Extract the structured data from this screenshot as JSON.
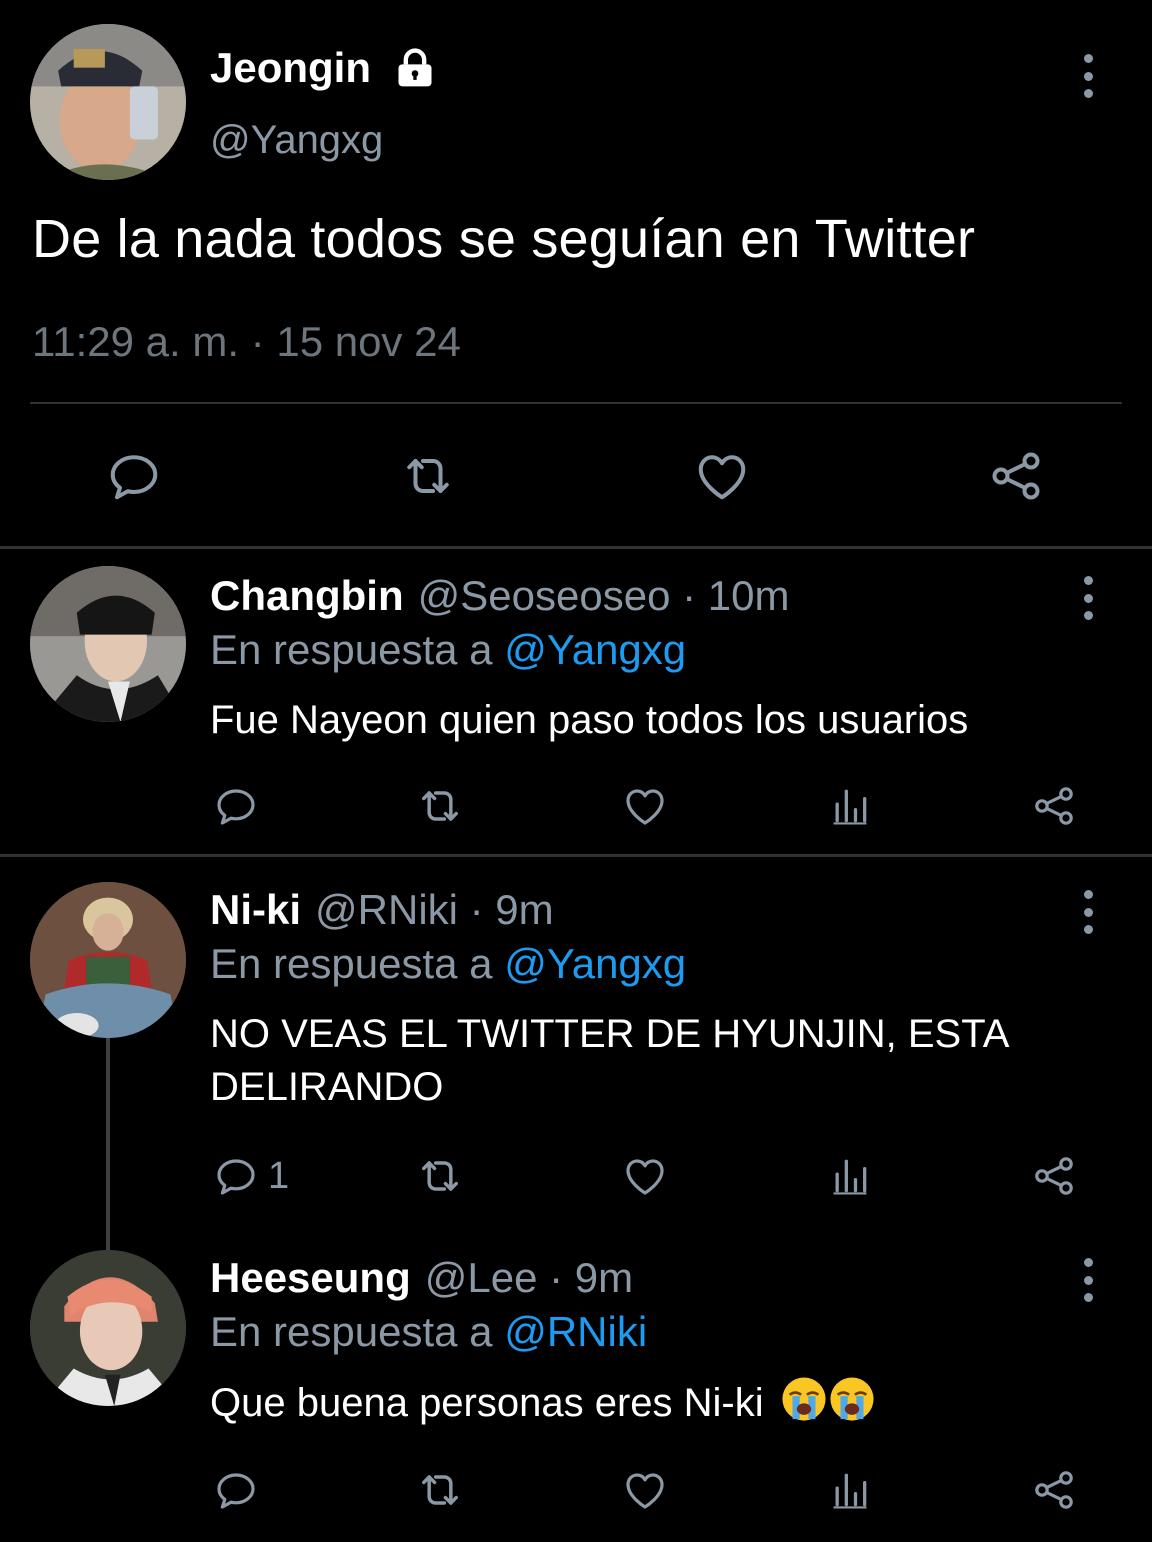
{
  "main_tweet": {
    "author_name": "Jeongin",
    "author_handle": "@Yangxg",
    "protected_icon": "lock-icon",
    "text": "De la nada todos se seguían en Twitter",
    "timestamp": "11:29 a. m. · 15 nov 24",
    "actions": [
      "reply-icon",
      "retweet-icon",
      "like-icon",
      "share-icon"
    ]
  },
  "replies": [
    {
      "author_name": "Changbin",
      "author_handle": "@Seoseoseo · 10m",
      "reply_to_prefix": "En respuesta a ",
      "reply_to": "@Yangxg",
      "text": "Fue Nayeon quien paso todos los usuarios",
      "reply_count": "",
      "actions": [
        "reply-icon",
        "retweet-icon",
        "like-icon",
        "views-icon",
        "share-icon"
      ]
    },
    {
      "author_name": "Ni-ki",
      "author_handle": "@RNiki · 9m",
      "reply_to_prefix": "En respuesta a ",
      "reply_to": "@Yangxg",
      "text": "NO VEAS EL TWITTER DE HYUNJIN, ESTA DELIRANDO",
      "reply_count": "1",
      "actions": [
        "reply-icon",
        "retweet-icon",
        "like-icon",
        "views-icon",
        "share-icon"
      ]
    },
    {
      "author_name": "Heeseung",
      "author_handle": "@Lee · 9m",
      "reply_to_prefix": "En respuesta a ",
      "reply_to": "@RNiki",
      "text": "Que buena personas eres Ni-ki",
      "emojis": [
        "crying-face-icon",
        "crying-face-icon"
      ],
      "reply_count": "",
      "actions": [
        "reply-icon",
        "retweet-icon",
        "like-icon",
        "views-icon",
        "share-icon"
      ]
    }
  ],
  "colors": {
    "background": "#000000",
    "text": "#ffffff",
    "secondary": "#8b98a5",
    "link": "#1d9bf0",
    "divider": "#2f3336"
  }
}
